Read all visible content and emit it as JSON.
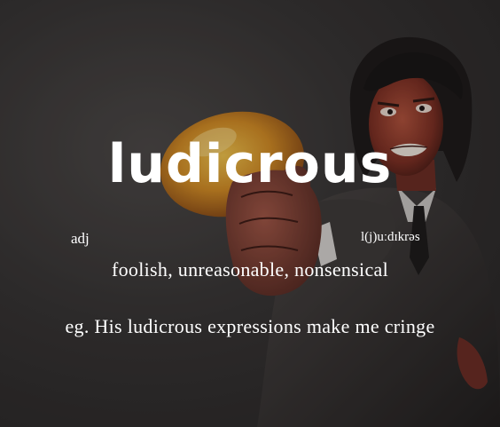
{
  "card": {
    "word": "ludicrous",
    "part_of_speech": "adj",
    "pronunciation": "l(j)uːdɪkrəs",
    "definition": "foolish, unreasonable, nonsensical",
    "example": "eg. His ludicrous expressions make me cringe"
  },
  "colors": {
    "background": "#2b2828",
    "text": "#ffffff",
    "fruit": "#d79a2c",
    "skin": "#8a3a2c",
    "suit": "#3a3635"
  }
}
